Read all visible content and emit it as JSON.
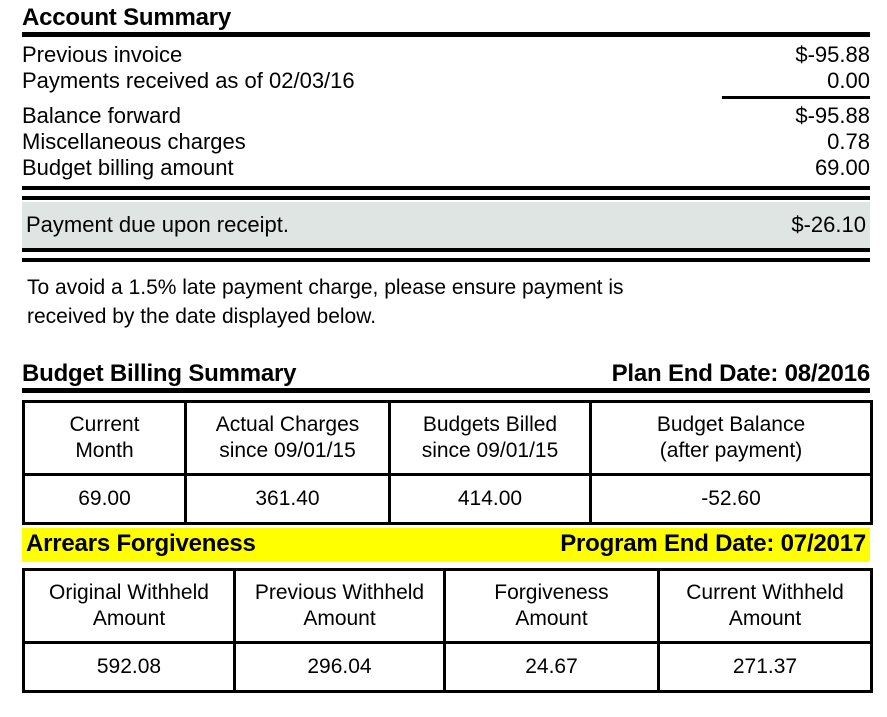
{
  "account_summary": {
    "heading": "Account Summary",
    "rows": [
      {
        "label": "Previous invoice",
        "amount": "$-95.88"
      },
      {
        "label": "Payments received as of 02/03/16",
        "amount": "0.00"
      },
      {
        "label": "Balance forward",
        "amount": "$-95.88"
      },
      {
        "label": "Miscellaneous charges",
        "amount": "0.78"
      },
      {
        "label": "Budget billing amount",
        "amount": "69.00"
      }
    ]
  },
  "payment_due": {
    "label": "Payment due upon receipt.",
    "amount": "$-26.10",
    "background_color": "#dfe5e3"
  },
  "late_notice": {
    "line1": "To avoid a 1.5% late payment charge, please ensure payment is",
    "line2": "received by the date displayed below."
  },
  "budget_billing": {
    "heading": "Budget Billing Summary",
    "end_date": "Plan End Date: 08/2016",
    "columns": [
      {
        "line1": "Current",
        "line2": "Month"
      },
      {
        "line1": "Actual Charges",
        "line2": "since 09/01/15"
      },
      {
        "line1": "Budgets Billed",
        "line2": "since 09/01/15"
      },
      {
        "line1": "Budget Balance",
        "line2": "(after payment)"
      }
    ],
    "values": [
      "69.00",
      "361.40",
      "414.00",
      "-52.60"
    ]
  },
  "arrears_forgiveness": {
    "heading": "Arrears Forgiveness",
    "end_date": "Program End Date: 07/2017",
    "highlight_color": "#ffff00",
    "columns": [
      {
        "line1": "Original Withheld",
        "line2": "Amount"
      },
      {
        "line1": "Previous Withheld",
        "line2": "Amount"
      },
      {
        "line1": "Forgiveness",
        "line2": "Amount"
      },
      {
        "line1": "Current Withheld",
        "line2": "Amount"
      }
    ],
    "values": [
      "592.08",
      "296.04",
      "24.67",
      "271.37"
    ]
  }
}
